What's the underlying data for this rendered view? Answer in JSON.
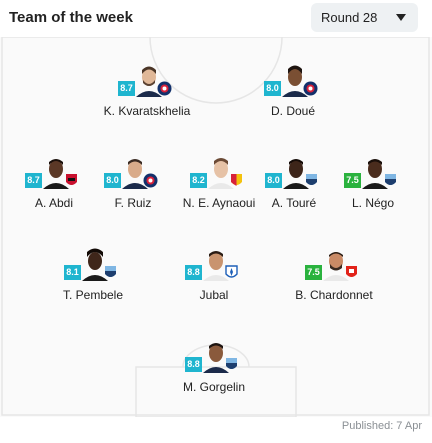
{
  "header": {
    "title": "Team of the week",
    "round_label": "Round 28"
  },
  "colors": {
    "rating_blue": "#1fb5cf",
    "rating_green": "#2ab23e"
  },
  "players": [
    {
      "name": "K. Kvaratskhelia",
      "rating": "8.7",
      "club_icon": "psg-crest-icon"
    },
    {
      "name": "D. Doué",
      "rating": "8.0",
      "club_icon": "psg-crest-icon"
    },
    {
      "name": "A. Abdi",
      "rating": "8.7",
      "club_icon": "nice-crest-icon"
    },
    {
      "name": "F. Ruiz",
      "rating": "8.0",
      "club_icon": "psg-crest-icon"
    },
    {
      "name": "N. E. Aynaoui",
      "rating": "8.2",
      "club_icon": "lens-crest-icon"
    },
    {
      "name": "A. Touré",
      "rating": "8.0",
      "club_icon": "le-havre-crest-icon"
    },
    {
      "name": "L. Négo",
      "rating": "7.5",
      "club_icon": "le-havre-crest-icon"
    },
    {
      "name": "T. Pembele",
      "rating": "8.1",
      "club_icon": "le-havre-crest-icon"
    },
    {
      "name": "Jubal",
      "rating": "8.8",
      "club_icon": "auxerre-crest-icon"
    },
    {
      "name": "B. Chardonnet",
      "rating": "7.5",
      "club_icon": "brest-crest-icon"
    },
    {
      "name": "M. Gorgelin",
      "rating": "8.8",
      "club_icon": "le-havre-crest-icon"
    }
  ],
  "footer": {
    "published": "Published: 7 Apr"
  }
}
